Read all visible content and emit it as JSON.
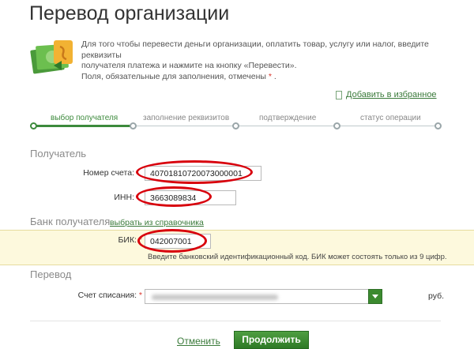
{
  "page": {
    "title": "Перевод организации"
  },
  "intro": {
    "line1": "Для того чтобы перевести деньги организации, оплатить товар, услугу или налог, введите реквизиты",
    "line2": "получателя платежа и нажмите на кнопку «Перевести».",
    "line3": "Поля, обязательные для заполнения, отмечены",
    "required_mark": "*",
    "line3_end": "."
  },
  "favorites": {
    "label": "Добавить в избранное",
    "icon": "bookmark-icon"
  },
  "steps": [
    {
      "label": "выбор получателя",
      "active": true
    },
    {
      "label": "заполнение реквизитов",
      "active": false
    },
    {
      "label": "подтверждение",
      "active": false
    },
    {
      "label": "статус операции",
      "active": false
    }
  ],
  "recipient": {
    "section_title": "Получатель",
    "account_label": "Номер счета:",
    "account_value": "40701810720073000001",
    "inn_label": "ИНН:",
    "inn_value": "3663089834"
  },
  "bank": {
    "section_title": "Банк получателя",
    "directory_link": "выбрать из справочника",
    "bik_label": "БИК:",
    "bik_required": "*",
    "bik_value": "042007001",
    "bik_hint": "Введите банковский идентификационный код. БИК может состоять только из 9 цифр."
  },
  "transfer": {
    "section_title": "Перевод",
    "debit_label": "Счет списания:",
    "debit_required": "*",
    "debit_currency": "руб."
  },
  "actions": {
    "cancel": "Отменить",
    "continue": "Продолжить"
  },
  "colors": {
    "accent_green": "#3c8a3c",
    "highlight_red": "#d8000c",
    "band_yellow": "#fdf9dd"
  }
}
